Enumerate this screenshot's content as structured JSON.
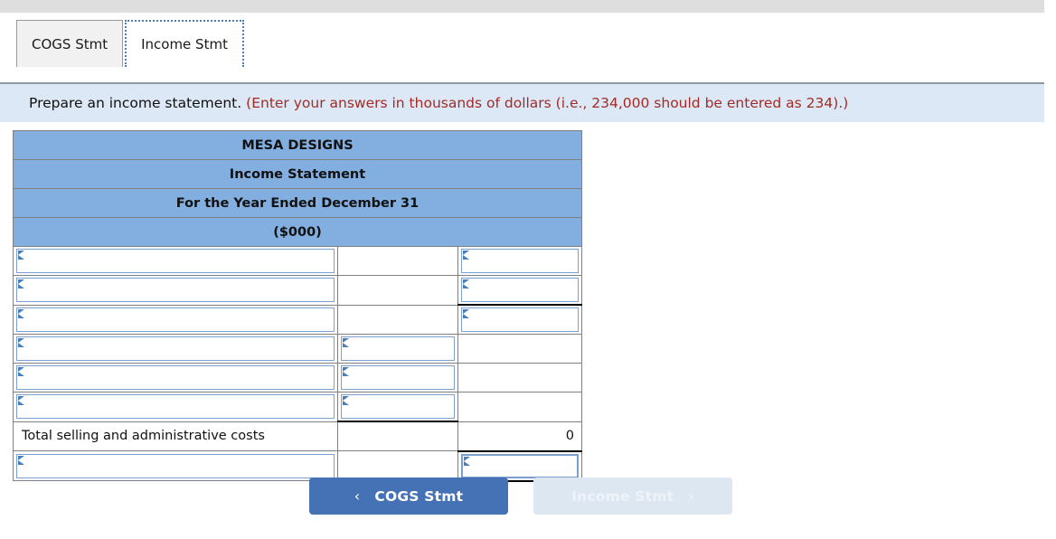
{
  "tabs": [
    {
      "label": "COGS Stmt",
      "active": false
    },
    {
      "label": "Income Stmt",
      "active": true
    }
  ],
  "banner": {
    "prompt": "Prepare an income statement.",
    "hint": "(Enter your answers in thousands of dollars (i.e., 234,000 should be entered as 234).)"
  },
  "statement": {
    "headers": [
      "MESA DESIGNS",
      "Income Statement",
      "For the Year Ended December 31",
      "($000)"
    ],
    "rows": [
      {
        "label": "",
        "mid": "",
        "right": ""
      },
      {
        "label": "",
        "mid": "",
        "right": ""
      },
      {
        "label": "",
        "mid": "",
        "right": ""
      },
      {
        "label": "",
        "mid": "",
        "right": ""
      },
      {
        "label": "",
        "mid": "",
        "right": ""
      },
      {
        "label": "",
        "mid": "",
        "right": ""
      },
      {
        "label": "Total selling and administrative costs",
        "mid": "",
        "right": "0"
      },
      {
        "label": "",
        "mid": "",
        "right": ""
      }
    ],
    "total_label": "Total selling and administrative costs",
    "total_value": "0"
  },
  "footer": {
    "prev_label": "COGS Stmt",
    "next_label": "Income Stmt",
    "prev_icon": "chevron-left-icon",
    "next_icon": "chevron-right-icon",
    "prev_chevron": "‹",
    "next_chevron": "›"
  },
  "colors": {
    "header_blue": "#82aee0",
    "banner_bg": "#dce8f5",
    "hint_red": "#a32b26",
    "button_blue": "#4472b4",
    "button_disabled": "#dde7f2",
    "input_border": "#7d9fcb"
  }
}
